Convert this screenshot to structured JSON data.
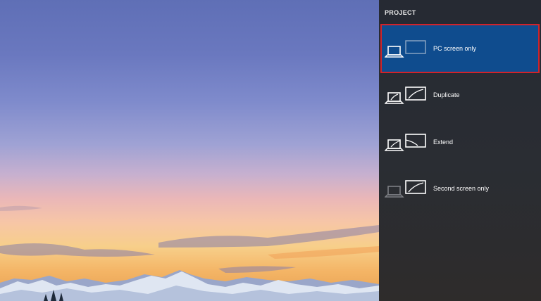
{
  "panel": {
    "title": "PROJECT",
    "options": [
      {
        "label": "PC screen only",
        "icon": "pc-screen-only-icon",
        "selected": true
      },
      {
        "label": "Duplicate",
        "icon": "duplicate-icon",
        "selected": false
      },
      {
        "label": "Extend",
        "icon": "extend-icon",
        "selected": false
      },
      {
        "label": "Second screen only",
        "icon": "second-screen-only-icon",
        "selected": false
      }
    ]
  },
  "colors": {
    "panel_bg": "#2a2d33",
    "selected_bg": "#0f4c8e",
    "highlight_border": "#d2232a",
    "text": "#ffffff"
  }
}
